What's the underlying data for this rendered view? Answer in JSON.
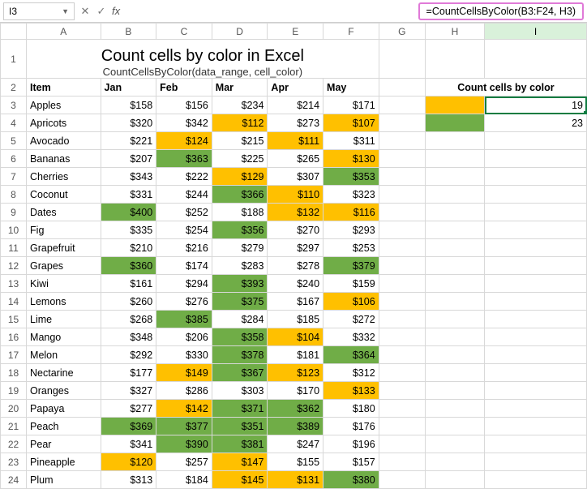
{
  "formula_bar": {
    "name_box": "I3",
    "cancel": "✕",
    "check": "✓",
    "fx": "fx",
    "formula": "=CountCellsByColor(B3:F24, H3)"
  },
  "columns": [
    "A",
    "B",
    "C",
    "D",
    "E",
    "F",
    "G",
    "H",
    "I"
  ],
  "title": "Count cells by color in Excel",
  "subtitle": "CountCellsByColor(data_range, cell_color)",
  "headers": {
    "item": "Item",
    "months": [
      "Jan",
      "Feb",
      "Mar",
      "Apr",
      "May"
    ],
    "count_label": "Count cells by color"
  },
  "results": {
    "orange": "19",
    "green": "23"
  },
  "rows": [
    {
      "n": 3,
      "item": "Apples",
      "vals": [
        "$158",
        "$156",
        "$234",
        "$214",
        "$171"
      ],
      "fills": [
        "",
        "",
        "",
        "",
        ""
      ]
    },
    {
      "n": 4,
      "item": "Apricots",
      "vals": [
        "$320",
        "$342",
        "$112",
        "$273",
        "$107"
      ],
      "fills": [
        "",
        "",
        "orange",
        "",
        "orange"
      ]
    },
    {
      "n": 5,
      "item": "Avocado",
      "vals": [
        "$221",
        "$124",
        "$215",
        "$111",
        "$311"
      ],
      "fills": [
        "",
        "orange",
        "",
        "orange",
        ""
      ]
    },
    {
      "n": 6,
      "item": "Bananas",
      "vals": [
        "$207",
        "$363",
        "$225",
        "$265",
        "$130"
      ],
      "fills": [
        "",
        "green",
        "",
        "",
        "orange"
      ]
    },
    {
      "n": 7,
      "item": "Cherries",
      "vals": [
        "$343",
        "$222",
        "$129",
        "$307",
        "$353"
      ],
      "fills": [
        "",
        "",
        "orange",
        "",
        "green"
      ]
    },
    {
      "n": 8,
      "item": "Coconut",
      "vals": [
        "$331",
        "$244",
        "$366",
        "$110",
        "$323"
      ],
      "fills": [
        "",
        "",
        "green",
        "orange",
        ""
      ]
    },
    {
      "n": 9,
      "item": "Dates",
      "vals": [
        "$400",
        "$252",
        "$188",
        "$132",
        "$116"
      ],
      "fills": [
        "green",
        "",
        "",
        "orange",
        "orange"
      ]
    },
    {
      "n": 10,
      "item": "Fig",
      "vals": [
        "$335",
        "$254",
        "$356",
        "$270",
        "$293"
      ],
      "fills": [
        "",
        "",
        "green",
        "",
        ""
      ]
    },
    {
      "n": 11,
      "item": "Grapefruit",
      "vals": [
        "$210",
        "$216",
        "$279",
        "$297",
        "$253"
      ],
      "fills": [
        "",
        "",
        "",
        "",
        ""
      ]
    },
    {
      "n": 12,
      "item": "Grapes",
      "vals": [
        "$360",
        "$174",
        "$283",
        "$278",
        "$379"
      ],
      "fills": [
        "green",
        "",
        "",
        "",
        "green"
      ]
    },
    {
      "n": 13,
      "item": "Kiwi",
      "vals": [
        "$161",
        "$294",
        "$393",
        "$240",
        "$159"
      ],
      "fills": [
        "",
        "",
        "green",
        "",
        ""
      ]
    },
    {
      "n": 14,
      "item": "Lemons",
      "vals": [
        "$260",
        "$276",
        "$375",
        "$167",
        "$106"
      ],
      "fills": [
        "",
        "",
        "green",
        "",
        "orange"
      ]
    },
    {
      "n": 15,
      "item": "Lime",
      "vals": [
        "$268",
        "$385",
        "$284",
        "$185",
        "$272"
      ],
      "fills": [
        "",
        "green",
        "",
        "",
        ""
      ]
    },
    {
      "n": 16,
      "item": "Mango",
      "vals": [
        "$348",
        "$206",
        "$358",
        "$104",
        "$332"
      ],
      "fills": [
        "",
        "",
        "green",
        "orange",
        ""
      ]
    },
    {
      "n": 17,
      "item": "Melon",
      "vals": [
        "$292",
        "$330",
        "$378",
        "$181",
        "$364"
      ],
      "fills": [
        "",
        "",
        "green",
        "",
        "green"
      ]
    },
    {
      "n": 18,
      "item": "Nectarine",
      "vals": [
        "$177",
        "$149",
        "$367",
        "$123",
        "$312"
      ],
      "fills": [
        "",
        "orange",
        "green",
        "orange",
        ""
      ]
    },
    {
      "n": 19,
      "item": "Oranges",
      "vals": [
        "$327",
        "$286",
        "$303",
        "$170",
        "$133"
      ],
      "fills": [
        "",
        "",
        "",
        "",
        "orange"
      ]
    },
    {
      "n": 20,
      "item": "Papaya",
      "vals": [
        "$277",
        "$142",
        "$371",
        "$362",
        "$180"
      ],
      "fills": [
        "",
        "orange",
        "green",
        "green",
        ""
      ]
    },
    {
      "n": 21,
      "item": "Peach",
      "vals": [
        "$369",
        "$377",
        "$351",
        "$389",
        "$176"
      ],
      "fills": [
        "green",
        "green",
        "green",
        "green",
        ""
      ]
    },
    {
      "n": 22,
      "item": "Pear",
      "vals": [
        "$341",
        "$390",
        "$381",
        "$247",
        "$196"
      ],
      "fills": [
        "",
        "green",
        "green",
        "",
        ""
      ]
    },
    {
      "n": 23,
      "item": "Pineapple",
      "vals": [
        "$120",
        "$257",
        "$147",
        "$155",
        "$157"
      ],
      "fills": [
        "orange",
        "",
        "orange",
        "",
        ""
      ]
    },
    {
      "n": 24,
      "item": "Plum",
      "vals": [
        "$313",
        "$184",
        "$145",
        "$131",
        "$380"
      ],
      "fills": [
        "",
        "",
        "orange",
        "orange",
        "green"
      ]
    }
  ]
}
